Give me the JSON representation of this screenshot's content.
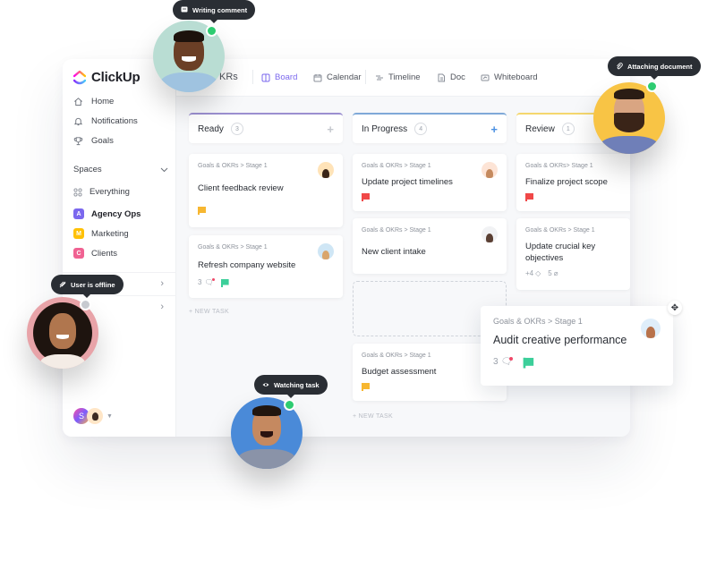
{
  "app": {
    "brand": "ClickUp",
    "nav": [
      {
        "label": "Home",
        "icon": "home-icon"
      },
      {
        "label": "Notifications",
        "icon": "bell-icon"
      },
      {
        "label": "Goals",
        "icon": "trophy-icon"
      }
    ],
    "spaces": {
      "heading": "Spaces",
      "items": [
        {
          "label": "Everything",
          "icon": "grid-icon"
        },
        {
          "label": "Agency Ops",
          "badge": "A",
          "color": "#7b68ee",
          "active": true
        },
        {
          "label": "Marketing",
          "badge": "M",
          "color": "#ffc107"
        },
        {
          "label": "Clients",
          "badge": "C",
          "color": "#f06292"
        }
      ]
    },
    "footer_user_initial": "S"
  },
  "topbar": {
    "list_name": "KRs",
    "tabs": [
      {
        "label": "Board",
        "icon": "board-icon",
        "active": true
      },
      {
        "label": "Calendar",
        "icon": "calendar-icon"
      },
      {
        "label": "Timeline",
        "icon": "timeline-icon"
      },
      {
        "label": "Doc",
        "icon": "doc-icon"
      },
      {
        "label": "Whiteboard",
        "icon": "whiteboard-icon"
      }
    ]
  },
  "board": {
    "new_task_label": "+ NEW TASK",
    "columns": [
      {
        "name": "Ready",
        "count": "3",
        "color": "#9b8fd0",
        "add_color": "#c5c8ce",
        "cards": [
          {
            "path": "Goals & OKRs > Stage 1",
            "title": "Client feedback review",
            "flag": "#f7b731"
          },
          {
            "path": "Goals & OKRs > Stage 1",
            "title": "Refresh company website",
            "comments": "3",
            "flag": "#3ccf9a"
          }
        ]
      },
      {
        "name": "In Progress",
        "count": "4",
        "color": "#7fa9d8",
        "add_color": "#4a90e2",
        "cards": [
          {
            "path": "Goals & OKRs > Stage 1",
            "title": "Update project timelines",
            "flag": "#f04848"
          },
          {
            "path": "Goals & OKRs > Stage 1",
            "title": "New client intake"
          },
          {
            "path": "Goals & OKRs > Stage 1",
            "title": "Budget assessment",
            "flag": "#f7b731"
          }
        ]
      },
      {
        "name": "Review",
        "count": "1",
        "color": "#f5d76e",
        "cards": [
          {
            "path": "Goals & OKRs> Stage 1",
            "title": "Finalize project scope",
            "flag": "#f04848"
          },
          {
            "path": "Goals & OKRs > Stage 1",
            "title": "Update crucial key objectives",
            "tags": "+4",
            "attachments": "5"
          }
        ]
      }
    ],
    "dragging_card": {
      "path": "Goals & OKRs > Stage 1",
      "title": "Audit creative performance",
      "comments": "3",
      "flag": "#3ccf9a"
    }
  },
  "presence": [
    {
      "name": "user-writing",
      "status": "Writing comment",
      "icon": "comment-icon",
      "online": true,
      "bg": "#b9ddd3"
    },
    {
      "name": "user-attaching",
      "status": "Attaching document",
      "icon": "paperclip-icon",
      "online": true,
      "bg": "#f8c445"
    },
    {
      "name": "user-offline",
      "status": "User is offline",
      "icon": "offline-icon",
      "online": false,
      "bg": "#e8a3a8"
    },
    {
      "name": "user-watching",
      "status": "Watching task",
      "icon": "eye-icon",
      "online": true,
      "bg": "#4a8ad8"
    }
  ],
  "colors": {
    "online": "#2ecc71",
    "offline": "#c7cad0",
    "accent": "#7b68ee"
  }
}
